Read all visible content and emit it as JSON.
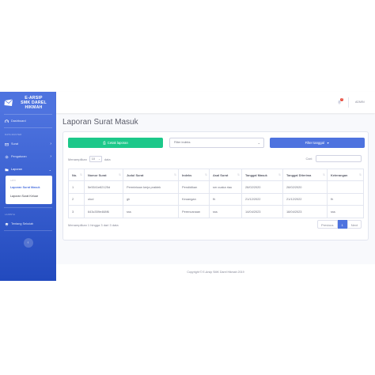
{
  "sidebar": {
    "brand_line1": "E-ARSIP",
    "brand_line2": "SMK DAREL",
    "brand_line3": "HIKMAH",
    "dashboard": "Dashboard",
    "heading_master": "DATA MASTER",
    "surat": "Surat",
    "pengaturan": "Pengaturan",
    "laporan": "Laporan",
    "collapse_header": "LAPO",
    "laporan_masuk": "Laporan Surat Masuk",
    "laporan_keluar": "Laporan Surat Keluar",
    "heading_lainnya": "LAINNYA",
    "tentang": "Tentang Sekolah"
  },
  "topbar": {
    "badge": "3",
    "user": "ADMIN"
  },
  "page": {
    "title": "Laporan Surat Masuk"
  },
  "toolbar": {
    "print_label": "Cetak laporan",
    "index_filter": "Filter indeks",
    "date_filter": "Filter tanggal"
  },
  "table_controls": {
    "show_prefix": "Menampilkan",
    "show_value": "10",
    "show_suffix": "data",
    "search_label": "Cari:"
  },
  "table": {
    "headers": [
      "No.",
      "Nomor Surat",
      "Judul Surat",
      "Indeks",
      "Asal Surat",
      "Tanggal Masuk",
      "Tanggal Diterima",
      "Keterangan"
    ],
    "rows": [
      [
        "1",
        "5e5541e82125d",
        "Permintaan kerja praktek",
        "Pendidikan",
        "sm cuaka riau",
        "28/02/2020",
        "28/02/2020",
        ""
      ],
      [
        "2",
        "olud",
        "gh",
        "Keuangan",
        "fh",
        "21/12/2022",
        "21/12/2022",
        "fh"
      ],
      [
        "3",
        "643c359e468f6",
        "sss",
        "Perencanaan",
        "sss",
        "14/04/2023",
        "18/04/2023",
        "sss"
      ]
    ]
  },
  "pagination": {
    "info": "Menampilkan 1 hingga 3 dari 3 data",
    "prev": "Previous",
    "current": "1",
    "next": "Next"
  },
  "footer": {
    "text": "Copyright © E-Arsip SMK Darel Hikmah 2019"
  },
  "colors": {
    "sidebar": "#4e73df",
    "print_button": "#1cc88a",
    "filter_button": "#4e73df",
    "badge": "#e74a3b"
  }
}
